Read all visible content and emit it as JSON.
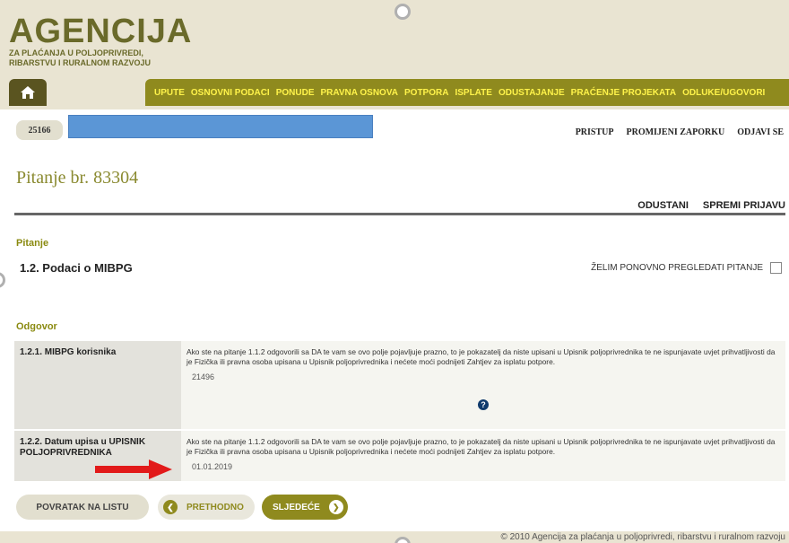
{
  "logo": {
    "title": "AGENCIJA",
    "subtitle": "ZA PLAĆANJA U POLJOPRIVREDI, RIBARSTVU I RURALNOM RAZVOJU"
  },
  "nav": {
    "items": [
      {
        "label": "UPUTE"
      },
      {
        "label": "OSNOVNI PODACI"
      },
      {
        "label": "PONUDE"
      },
      {
        "label": "PRAVNA OSNOVA"
      },
      {
        "label": "POTPORA"
      },
      {
        "label": "ISPLATE"
      },
      {
        "label": "ODUSTAJANJE"
      },
      {
        "label": "PRAĆENJE PROJEKATA"
      },
      {
        "label": "ODLUKE/UGOVORI"
      }
    ]
  },
  "user": {
    "id": "25166",
    "links": [
      "PRISTUP",
      "PROMIJENI ZAPORKU",
      "ODJAVI SE"
    ]
  },
  "page": {
    "title": "Pitanje br. 83304",
    "actions": [
      "ODUSTANI",
      "SPREMI PRIJAVU"
    ]
  },
  "question": {
    "section_label": "Pitanje",
    "title": "1.2. Podaci o MIBPG",
    "review_label": "ŽELIM PONOVNO PREGLEDATI PITANJE"
  },
  "answer": {
    "section_label": "Odgovor",
    "rows": [
      {
        "label": "1.2.1. MIBPG korisnika",
        "note": "Ako ste na pitanje 1.1.2 odgovorili sa DA te vam se ovo polje pojavljuje prazno, to je pokazatelj da niste upisani u Upisnik poljoprivrednika te ne ispunjavate uvjet prihvatljivosti da je Fizička ili pravna osoba upisana u Upisnik poljoprivrednika i nećete moći podnijeti Zahtjev za isplatu potpore.",
        "value": "21496"
      },
      {
        "label": "1.2.2. Datum upisa u UPISNIK POLJOPRIVREDNIKA",
        "note": "Ako ste na pitanje 1.1.2 odgovorili sa DA te vam se ovo polje pojavljuje prazno, to je pokazatelj da niste upisani u Upisnik poljoprivrednika te ne ispunjavate uvjet prihvatljivosti da je Fizička ili pravna osoba upisana u Upisnik poljoprivrednika i nećete moći podnijeti Zahtjev za isplatu potpore.",
        "value": "01.01.2019"
      }
    ]
  },
  "buttons": {
    "back": "POVRATAK NA LISTU",
    "prev": "PRETHODNO",
    "next": "SLJEDEĆE"
  },
  "footer": {
    "text": "© 2010 Agencija za plaćanja u poljoprivredi, ribarstvu i ruralnom razvoju"
  },
  "icons": {
    "home": "home-icon",
    "help": "help-icon",
    "prev": "chevron-left-icon",
    "next": "chevron-right-icon",
    "arrow": "red-arrow-icon"
  },
  "colors": {
    "nav_bg": "#8f8a1e",
    "header_bg": "#e9e4d2",
    "accent_text": "#8a8a10",
    "arrow": "#e21a1a"
  }
}
